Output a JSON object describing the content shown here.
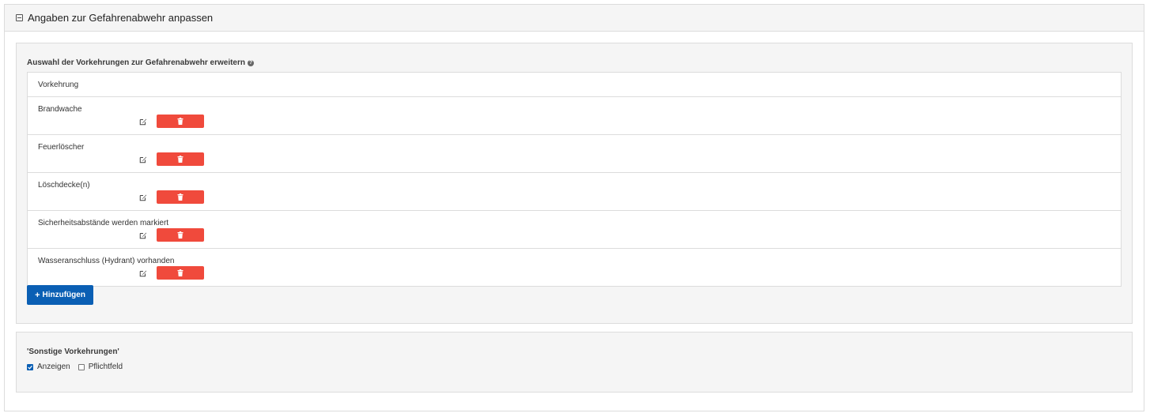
{
  "header": {
    "title": "Angaben zur Gefahrenabwehr anpassen"
  },
  "measures": {
    "label": "Auswahl der Vorkehrungen zur Gefahrenabwehr erweitern",
    "help": "?",
    "column_header": "Vorkehrung",
    "rows": [
      {
        "label": "Brandwache"
      },
      {
        "label": "Feuerlöscher"
      },
      {
        "label": "Löschdecke(n)"
      },
      {
        "label": "Sicherheitsabstände werden markiert"
      },
      {
        "label": "Wasseranschluss (Hydrant) vorhanden"
      }
    ],
    "add_icon": "+",
    "add_label": "Hinzufügen"
  },
  "other": {
    "label": "'Sonstige Vorkehrungen'",
    "show_label": "Anzeigen",
    "show_checked": true,
    "required_label": "Pflichtfeld",
    "required_checked": false
  },
  "colors": {
    "delete": "#f04a3c",
    "primary": "#0a5fb4",
    "panel_bg": "#f5f5f5",
    "border": "#dcdcdc"
  },
  "icons": {
    "collapse": "minus-square-icon",
    "help": "question-circle-icon",
    "edit": "edit-icon",
    "delete": "trash-icon",
    "add": "plus-icon",
    "checkbox": "check-icon"
  }
}
